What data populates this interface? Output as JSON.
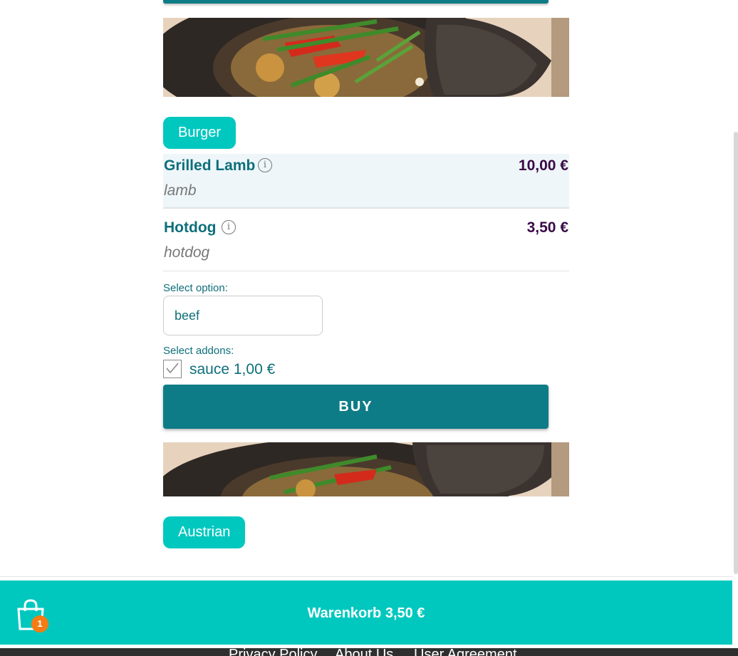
{
  "menu": {
    "categories": {
      "burger": "Burger",
      "austrian": "Austrian"
    },
    "items": [
      {
        "name": "Grilled Lamb",
        "price": "10,00 €",
        "description": "lamb"
      },
      {
        "name": "Hotdog",
        "price": "3,50 €",
        "description": "hotdog"
      }
    ],
    "info_icon_glyph": "i"
  },
  "order": {
    "select_option_label": "Select option:",
    "selected_option": "beef",
    "select_addons_label": "Select addons:",
    "addon_label": "sauce 1,00 €",
    "addon_checked": true,
    "buy_label": "BUY"
  },
  "cart": {
    "icon": "shopping-bag-icon",
    "count": "1",
    "total_label": "Warenkorb 3,50 €"
  },
  "footer": {
    "links": [
      "Privacy Policy",
      "About Us",
      "User Agreement"
    ]
  },
  "colors": {
    "teal_dark": "#0e7c86",
    "teal_accent": "#00c8bf",
    "price": "#3a0a47",
    "badge": "#f57c14"
  }
}
